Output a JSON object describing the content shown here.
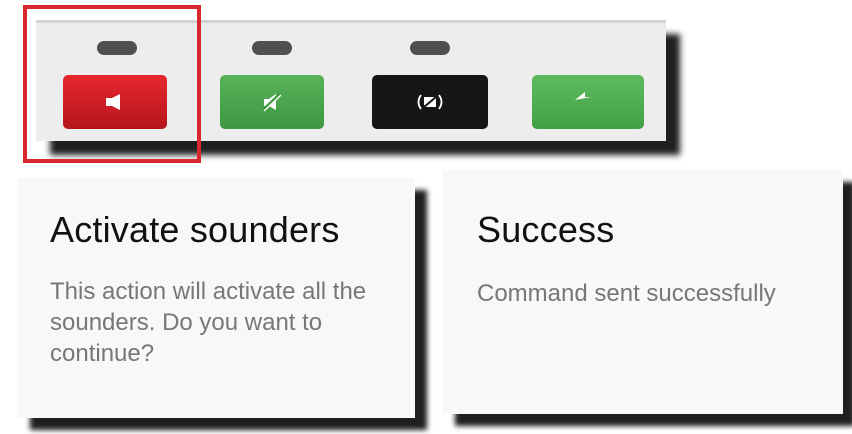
{
  "panel": {
    "buttons": [
      {
        "icon": "sounder-on-icon",
        "color": "#d01f26"
      },
      {
        "icon": "sounder-mute-icon",
        "color": "#4ca64e"
      },
      {
        "icon": "sounder-silence-icon",
        "color": "#161616"
      },
      {
        "icon": "back-arrow-icon",
        "color": "#4caf50"
      }
    ],
    "highlight_color": "#d9272e"
  },
  "dialog_activate": {
    "title": "Activate sounders",
    "message": "This action will activate all the sounders. Do you want to continue?"
  },
  "dialog_success": {
    "title": "Success",
    "message": "Command sent successfully"
  }
}
